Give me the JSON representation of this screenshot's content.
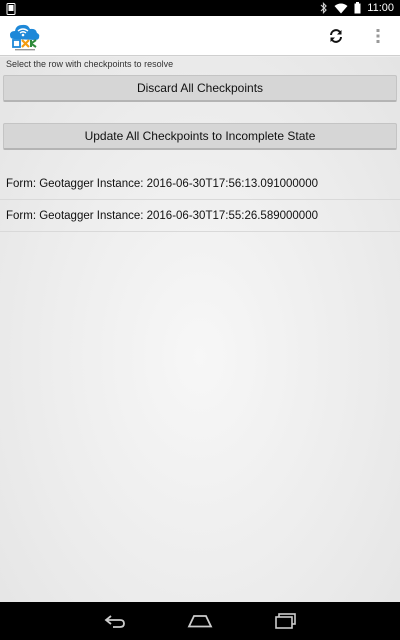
{
  "status_bar": {
    "time": "11:00",
    "icons": [
      "phone-notification-icon",
      "bluetooth-icon",
      "wifi-icon",
      "battery-icon"
    ]
  },
  "action_bar": {
    "icons": [
      "app-logo-icon",
      "refresh-icon",
      "overflow-menu-icon"
    ]
  },
  "content": {
    "hint": "Select the row with checkpoints to resolve",
    "discard_label": "Discard All Checkpoints",
    "update_label": "Update All Checkpoints to Incomplete State",
    "items": [
      {
        "label": "Form: Geotagger Instance: 2016-06-30T17:56:13.091000000"
      },
      {
        "label": "Form: Geotagger Instance: 2016-06-30T17:55:26.589000000"
      }
    ]
  },
  "nav_bar": {
    "icons": [
      "back-icon",
      "home-icon",
      "recents-icon"
    ]
  },
  "colors": {
    "status_bar": "#000000",
    "action_bar": "#ffffff",
    "button": "#d6d6d6",
    "content_bg": "#ececec",
    "logo_blue": "#1e88d8"
  }
}
